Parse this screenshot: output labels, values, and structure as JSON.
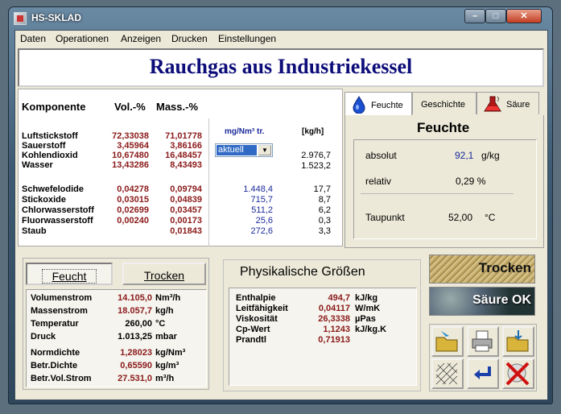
{
  "window": {
    "title": "HS-SKLAD",
    "min_glyph": "–",
    "max_glyph": "□",
    "close_glyph": "✕"
  },
  "menu": [
    "Daten",
    "Operationen",
    "Anzeigen",
    "Drucken",
    "Einstellungen"
  ],
  "banner_title": "Rauchgas aus Industriekessel",
  "components": {
    "header": {
      "name": "Komponente",
      "vol": "Vol.-%",
      "mass": "Mass.-%"
    },
    "group1": [
      {
        "name": "Luftstickstoff",
        "vol": "72,33038",
        "mass": "71,01778"
      },
      {
        "name": "Sauerstoff",
        "vol": "3,45964",
        "mass": "3,86166"
      },
      {
        "name": "Kohlendioxid",
        "vol": "10,67480",
        "mass": "16,48457"
      },
      {
        "name": "Wasser",
        "vol": "13,43286",
        "mass": "8,43493"
      }
    ],
    "group2": [
      {
        "name": "Schwefelodide",
        "vol": "0,04278",
        "mass": "0,09794"
      },
      {
        "name": "Stickoxide",
        "vol": "0,03015",
        "mass": "0,04839"
      },
      {
        "name": "Chlorwasserstoff",
        "vol": "0,02699",
        "mass": "0,03457"
      },
      {
        "name": "Fluorwasserstoff",
        "vol": "0,00240",
        "mass": "0,00173"
      },
      {
        "name": "Staub",
        "vol": "",
        "mass": "0,01843"
      }
    ]
  },
  "flows": {
    "unit_mg": "mg/Nm³ tr.",
    "unit_kgh": "[kg/h]",
    "select_value": "aktuell",
    "group1": [
      {
        "mg": "",
        "kgh": "2.976,7"
      },
      {
        "mg": "",
        "kgh": "1.523,2"
      }
    ],
    "group2": [
      {
        "mg": "1.448,4",
        "kgh": "17,7"
      },
      {
        "mg": "715,7",
        "kgh": "8,7"
      },
      {
        "mg": "511,2",
        "kgh": "6,2"
      },
      {
        "mg": "25,6",
        "kgh": "0,3"
      },
      {
        "mg": "272,6",
        "kgh": "3,3"
      }
    ]
  },
  "tabs": {
    "feuchte": "Feuchte",
    "geschichte": "Geschichte",
    "saeure": "Säure"
  },
  "feuchte": {
    "heading": "Feuchte",
    "absolut_label": "absolut",
    "absolut_value": "92,1",
    "absolut_unit": "g/kg",
    "relativ_label": "relativ",
    "relativ_value": "0,29 %",
    "taupunkt_label": "Taupunkt",
    "taupunkt_value": "52,00",
    "taupunkt_unit": "°C"
  },
  "mode": {
    "feucht": "Feucht",
    "trocken": "Trocken"
  },
  "properties": [
    {
      "label": "Volumenstrom",
      "value": "14.105,0",
      "unit": "Nm³/h",
      "color": "red"
    },
    {
      "label": "Massenstrom",
      "value": "18.057,7",
      "unit": "kg/h",
      "color": "red"
    },
    {
      "label": "Temperatur",
      "value": "260,00",
      "unit": "°C",
      "color": "black"
    },
    {
      "label": "Druck",
      "value": "1.013,25",
      "unit": "mbar",
      "color": "black"
    }
  ],
  "properties2": [
    {
      "label": "Normdichte",
      "value": "1,28023",
      "unit": "kg/Nm³",
      "color": "red"
    },
    {
      "label": "Betr.Dichte",
      "value": "0,65590",
      "unit": "kg/m³",
      "color": "red"
    },
    {
      "label": "Betr.Vol.Strom",
      "value": "27.531,0",
      "unit": "m³/h",
      "color": "red"
    }
  ],
  "physical": {
    "heading": "Physikalische Größen",
    "rows": [
      {
        "label": "Enthalpie",
        "value": "494,7",
        "unit": "kJ/kg"
      },
      {
        "label": "Leitfähigkeit",
        "value": "0,04117",
        "unit": "W/mK"
      },
      {
        "label": "Viskosität",
        "value": "26,3338",
        "unit": "µPas"
      },
      {
        "label": "Cp-Wert",
        "value": "1,1243",
        "unit": "kJ/kg.K"
      },
      {
        "label": "Prandtl",
        "value": "0,71913",
        "unit": ""
      }
    ]
  },
  "status": {
    "trocken": "Trocken",
    "saeure_ok": "Säure OK"
  }
}
